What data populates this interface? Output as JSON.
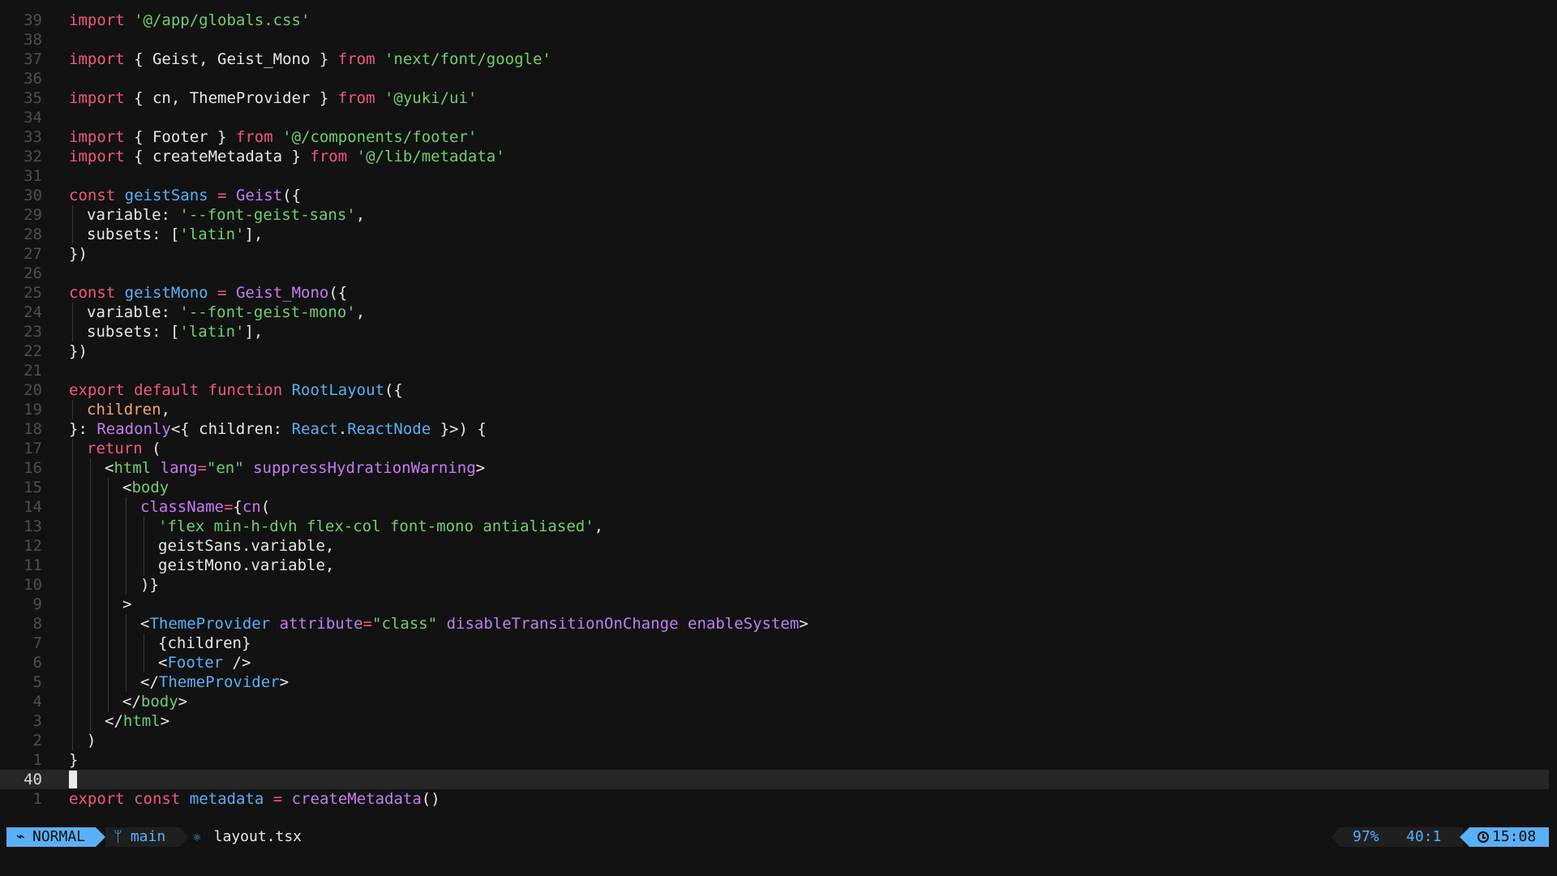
{
  "editor": {
    "lines": [
      {
        "num": "39",
        "indent": 0,
        "tokens": [
          [
            "kw",
            "import"
          ],
          [
            "plain",
            " "
          ],
          [
            "str",
            "'@/app/globals.css'"
          ]
        ]
      },
      {
        "num": "38",
        "indent": 0,
        "tokens": []
      },
      {
        "num": "37",
        "indent": 0,
        "tokens": [
          [
            "kw",
            "import"
          ],
          [
            "plain",
            " { Geist, Geist_Mono } "
          ],
          [
            "kw",
            "from"
          ],
          [
            "plain",
            " "
          ],
          [
            "str",
            "'next/font/google'"
          ]
        ]
      },
      {
        "num": "36",
        "indent": 0,
        "tokens": []
      },
      {
        "num": "35",
        "indent": 0,
        "tokens": [
          [
            "kw",
            "import"
          ],
          [
            "plain",
            " { cn, ThemeProvider } "
          ],
          [
            "kw",
            "from"
          ],
          [
            "plain",
            " "
          ],
          [
            "str",
            "'@yuki/ui'"
          ]
        ]
      },
      {
        "num": "34",
        "indent": 0,
        "tokens": []
      },
      {
        "num": "33",
        "indent": 0,
        "tokens": [
          [
            "kw",
            "import"
          ],
          [
            "plain",
            " { Footer } "
          ],
          [
            "kw",
            "from"
          ],
          [
            "plain",
            " "
          ],
          [
            "str",
            "'@/components/footer'"
          ]
        ]
      },
      {
        "num": "32",
        "indent": 0,
        "tokens": [
          [
            "kw",
            "import"
          ],
          [
            "plain",
            " { createMetadata } "
          ],
          [
            "kw",
            "from"
          ],
          [
            "plain",
            " "
          ],
          [
            "str",
            "'@/lib/metadata'"
          ]
        ]
      },
      {
        "num": "31",
        "indent": 0,
        "tokens": []
      },
      {
        "num": "30",
        "indent": 0,
        "tokens": [
          [
            "kw",
            "const"
          ],
          [
            "plain",
            " "
          ],
          [
            "var",
            "geistSans"
          ],
          [
            "plain",
            " "
          ],
          [
            "kw",
            "="
          ],
          [
            "plain",
            " "
          ],
          [
            "fn",
            "Geist"
          ],
          [
            "plain",
            "({"
          ]
        ]
      },
      {
        "num": "29",
        "indent": 1,
        "tokens": [
          [
            "plain",
            "variable: "
          ],
          [
            "str",
            "'--font-geist-sans'"
          ],
          [
            "plain",
            ","
          ]
        ]
      },
      {
        "num": "28",
        "indent": 1,
        "tokens": [
          [
            "plain",
            "subsets: ["
          ],
          [
            "str",
            "'latin'"
          ],
          [
            "plain",
            "],"
          ]
        ]
      },
      {
        "num": "27",
        "indent": 0,
        "tokens": [
          [
            "plain",
            "})"
          ]
        ]
      },
      {
        "num": "26",
        "indent": 0,
        "tokens": []
      },
      {
        "num": "25",
        "indent": 0,
        "tokens": [
          [
            "kw",
            "const"
          ],
          [
            "plain",
            " "
          ],
          [
            "var",
            "geistMono"
          ],
          [
            "plain",
            " "
          ],
          [
            "kw",
            "="
          ],
          [
            "plain",
            " "
          ],
          [
            "fn",
            "Geist_Mono"
          ],
          [
            "plain",
            "({"
          ]
        ]
      },
      {
        "num": "24",
        "indent": 1,
        "tokens": [
          [
            "plain",
            "variable: "
          ],
          [
            "str",
            "'--font-geist-mono'"
          ],
          [
            "plain",
            ","
          ]
        ]
      },
      {
        "num": "23",
        "indent": 1,
        "tokens": [
          [
            "plain",
            "subsets: ["
          ],
          [
            "str",
            "'latin'"
          ],
          [
            "plain",
            "],"
          ]
        ]
      },
      {
        "num": "22",
        "indent": 0,
        "tokens": [
          [
            "plain",
            "})"
          ]
        ]
      },
      {
        "num": "21",
        "indent": 0,
        "tokens": []
      },
      {
        "num": "20",
        "indent": 0,
        "tokens": [
          [
            "kw",
            "export"
          ],
          [
            "plain",
            " "
          ],
          [
            "kw",
            "default"
          ],
          [
            "plain",
            " "
          ],
          [
            "kw",
            "function"
          ],
          [
            "plain",
            " "
          ],
          [
            "var",
            "RootLayout"
          ],
          [
            "plain",
            "({"
          ]
        ]
      },
      {
        "num": "19",
        "indent": 1,
        "tokens": [
          [
            "param",
            "children"
          ],
          [
            "plain",
            ","
          ]
        ]
      },
      {
        "num": "18",
        "indent": 0,
        "tokens": [
          [
            "plain",
            "}: "
          ],
          [
            "type",
            "Readonly"
          ],
          [
            "plain",
            "<{ children: "
          ],
          [
            "comp",
            "React"
          ],
          [
            "plain",
            "."
          ],
          [
            "comp",
            "ReactNode"
          ],
          [
            "plain",
            " }>) {"
          ]
        ]
      },
      {
        "num": "17",
        "indent": 1,
        "tokens": [
          [
            "kw",
            "return"
          ],
          [
            "plain",
            " ("
          ]
        ]
      },
      {
        "num": "16",
        "indent": 2,
        "tokens": [
          [
            "plain",
            "<"
          ],
          [
            "tag",
            "html"
          ],
          [
            "plain",
            " "
          ],
          [
            "attr",
            "lang"
          ],
          [
            "kw",
            "="
          ],
          [
            "str",
            "\"en\""
          ],
          [
            "plain",
            " "
          ],
          [
            "attr",
            "suppressHydrationWarning"
          ],
          [
            "plain",
            ">"
          ]
        ]
      },
      {
        "num": "15",
        "indent": 3,
        "tokens": [
          [
            "plain",
            "<"
          ],
          [
            "tag",
            "body"
          ]
        ]
      },
      {
        "num": "14",
        "indent": 4,
        "tokens": [
          [
            "attr",
            "className"
          ],
          [
            "kw",
            "="
          ],
          [
            "plain",
            "{"
          ],
          [
            "fn",
            "cn"
          ],
          [
            "plain",
            "("
          ]
        ]
      },
      {
        "num": "13",
        "indent": 5,
        "tokens": [
          [
            "str",
            "'flex min-h-dvh flex-col font-mono antialiased'"
          ],
          [
            "plain",
            ","
          ]
        ]
      },
      {
        "num": "12",
        "indent": 5,
        "tokens": [
          [
            "plain",
            "geistSans.variable,"
          ]
        ]
      },
      {
        "num": "11",
        "indent": 5,
        "tokens": [
          [
            "plain",
            "geistMono.variable,"
          ]
        ]
      },
      {
        "num": "10",
        "indent": 4,
        "tokens": [
          [
            "plain",
            ")}"
          ]
        ]
      },
      {
        "num": "9",
        "indent": 3,
        "tokens": [
          [
            "plain",
            ">"
          ]
        ]
      },
      {
        "num": "8",
        "indent": 4,
        "tokens": [
          [
            "plain",
            "<"
          ],
          [
            "comp",
            "ThemeProvider"
          ],
          [
            "plain",
            " "
          ],
          [
            "attr",
            "attribute"
          ],
          [
            "kw",
            "="
          ],
          [
            "str",
            "\"class\""
          ],
          [
            "plain",
            " "
          ],
          [
            "attr",
            "disableTransitionOnChange"
          ],
          [
            "plain",
            " "
          ],
          [
            "attr",
            "enableSystem"
          ],
          [
            "plain",
            ">"
          ]
        ]
      },
      {
        "num": "7",
        "indent": 5,
        "tokens": [
          [
            "plain",
            "{children}"
          ]
        ]
      },
      {
        "num": "6",
        "indent": 5,
        "tokens": [
          [
            "plain",
            "<"
          ],
          [
            "comp",
            "Footer"
          ],
          [
            "plain",
            " />"
          ]
        ]
      },
      {
        "num": "5",
        "indent": 4,
        "tokens": [
          [
            "plain",
            "</"
          ],
          [
            "comp",
            "ThemeProvider"
          ],
          [
            "plain",
            ">"
          ]
        ]
      },
      {
        "num": "4",
        "indent": 3,
        "tokens": [
          [
            "plain",
            "</"
          ],
          [
            "tag",
            "body"
          ],
          [
            "plain",
            ">"
          ]
        ]
      },
      {
        "num": "3",
        "indent": 2,
        "tokens": [
          [
            "plain",
            "</"
          ],
          [
            "tag",
            "html"
          ],
          [
            "plain",
            ">"
          ]
        ]
      },
      {
        "num": "2",
        "indent": 1,
        "tokens": [
          [
            "plain",
            ")"
          ]
        ]
      },
      {
        "num": "1",
        "indent": 0,
        "tokens": [
          [
            "plain",
            "}"
          ]
        ]
      },
      {
        "num": "40",
        "indent": 0,
        "current": true,
        "tokens": []
      },
      {
        "num": "1",
        "indent": 0,
        "tokens": [
          [
            "kw",
            "export"
          ],
          [
            "plain",
            " "
          ],
          [
            "kw",
            "const"
          ],
          [
            "plain",
            " "
          ],
          [
            "var",
            "metadata"
          ],
          [
            "plain",
            " "
          ],
          [
            "kw",
            "="
          ],
          [
            "plain",
            " "
          ],
          [
            "fn",
            "createMetadata"
          ],
          [
            "plain",
            "()"
          ]
        ]
      }
    ]
  },
  "statusline": {
    "mode": "NORMAL",
    "mode_icon": "vim-icon",
    "branch": "main",
    "branch_icon": "git-branch-icon",
    "file_icon": "react-icon",
    "filename": "layout.tsx",
    "percent": "97%",
    "cursor_position": "40:1",
    "clock_icon": "clock-icon",
    "time": "15:08"
  },
  "colors": {
    "background": "#121212",
    "keyword": "#f2587f",
    "string": "#6fcf70",
    "variable": "#5ab0f6",
    "function": "#c47cf5",
    "parameter": "#f7a56b",
    "accent": "#5ab0f6"
  }
}
